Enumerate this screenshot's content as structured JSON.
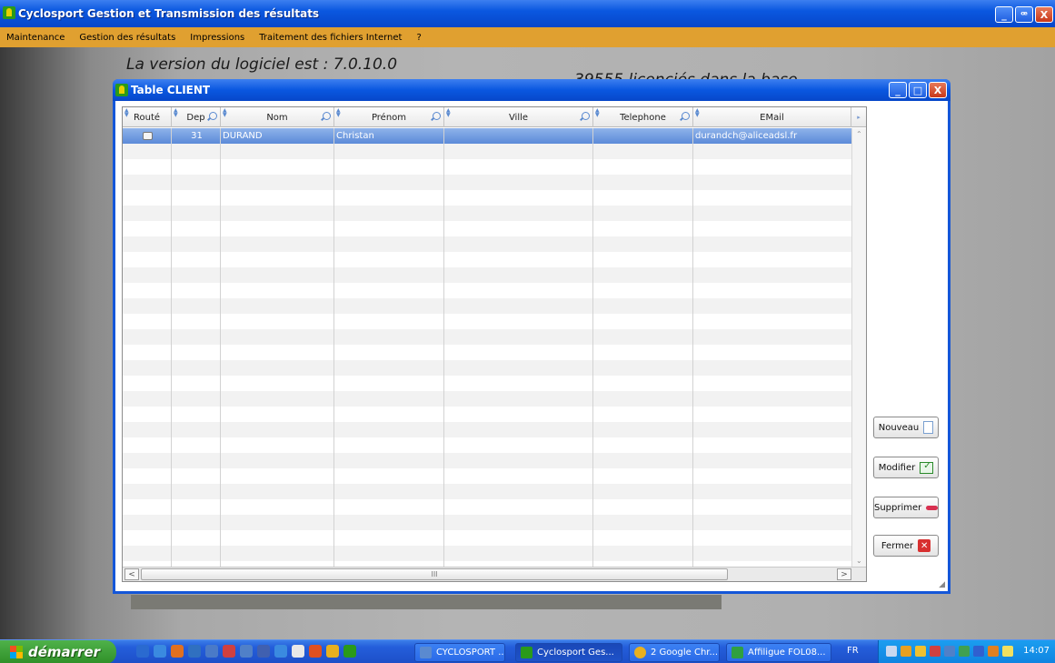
{
  "app": {
    "title": "Cyclosport Gestion et Transmission des résultats",
    "window_buttons": {
      "minimize": "_",
      "restore": "ꟹ",
      "close": "X"
    }
  },
  "menu": [
    "Maintenance",
    "Gestion des résultats",
    "Impressions",
    "Traitement des fichiers Internet",
    "?"
  ],
  "background_text": {
    "version": "La version  du logiciel est : 7.0.10.0",
    "licenses": "39555 licenciés dans la base"
  },
  "dialog": {
    "title": "Table CLIENT",
    "window_buttons": {
      "minimize": "_",
      "maximize": "□",
      "close": "X"
    },
    "table": {
      "columns": [
        "Routé",
        "Dep",
        "Nom",
        "Prénom",
        "Ville",
        "Telephone",
        "EMail"
      ],
      "rows": [
        {
          "route": false,
          "dep": "31",
          "nom": "DURAND",
          "prenom": "Christan",
          "ville": "",
          "telephone": "",
          "email": "durandch@aliceadsl.fr"
        }
      ],
      "scroll_thumb_label": "III"
    },
    "buttons": {
      "new": "Nouveau",
      "edit": "Modifier",
      "delete": "Supprimer",
      "close": "Fermer"
    }
  },
  "taskbar": {
    "start_label": "démarrer",
    "tasks": [
      {
        "label": "CYCLOSPORT ...",
        "icon_color": "#5a8ad0"
      },
      {
        "label": "Cyclosport Ges...",
        "icon_color": "#2a9a1a"
      },
      {
        "label": "2 Google Chr...",
        "icon_color": "#e8b020"
      },
      {
        "label": "Affiligue FOL08...",
        "icon_color": "#30a040"
      }
    ],
    "language": "FR",
    "clock": "14:07"
  },
  "colors": {
    "title_bar": "#0a57e0",
    "menu_bar": "#e0a030",
    "selected_row": "#6b94dc",
    "start_button": "#3a9c33",
    "tray": "#1592e8"
  }
}
